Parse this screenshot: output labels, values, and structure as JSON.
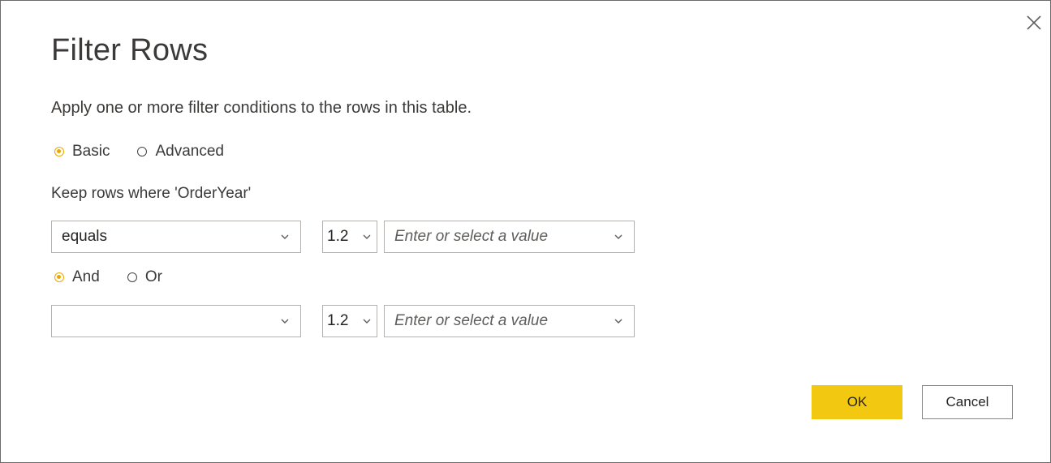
{
  "dialog": {
    "title": "Filter Rows",
    "description": "Apply one or more filter conditions to the rows in this table.",
    "close_icon": "close-icon",
    "mode": {
      "options": [
        {
          "label": "Basic",
          "selected": true
        },
        {
          "label": "Advanced",
          "selected": false
        }
      ]
    },
    "keep_label": "Keep rows where 'OrderYear'",
    "conditions": [
      {
        "operator": "equals",
        "type": "1.2",
        "value_placeholder": "Enter or select a value"
      },
      {
        "operator": "",
        "type": "1.2",
        "value_placeholder": "Enter or select a value"
      }
    ],
    "logic": {
      "options": [
        {
          "label": "And",
          "selected": true
        },
        {
          "label": "Or",
          "selected": false
        }
      ]
    },
    "buttons": {
      "ok": "OK",
      "cancel": "Cancel"
    }
  },
  "colors": {
    "accent": "#f2c811",
    "radio_selected": "#e8a800",
    "border": "#b3b0ad"
  },
  "icons": {
    "dropdown": "chevron-down-icon"
  }
}
